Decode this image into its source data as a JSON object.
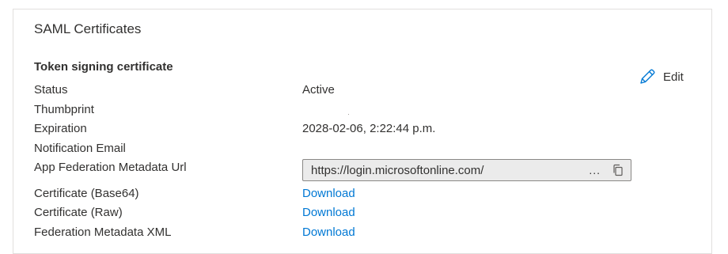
{
  "card": {
    "title": "SAML Certificates",
    "section_title": "Token signing certificate",
    "edit_label": "Edit",
    "edit_icon": "pencil-icon",
    "accent_color": "#0078d4"
  },
  "rows": {
    "status": {
      "label": "Status",
      "value": "Active"
    },
    "thumbprint": {
      "label": "Thumbprint",
      "value": ""
    },
    "expiration": {
      "label": "Expiration",
      "value": "2028-02-06, 2:22:44 p.m."
    },
    "notification_email": {
      "label": "Notification Email",
      "value": ""
    },
    "metadata_url": {
      "label": "App Federation Metadata Url",
      "value": "https://login.microsoftonline.com/",
      "ellipsis": "...",
      "copy_icon": "copy-icon"
    },
    "cert_base64": {
      "label": "Certificate (Base64)",
      "link": "Download"
    },
    "cert_raw": {
      "label": "Certificate (Raw)",
      "link": "Download"
    },
    "federation_xml": {
      "label": "Federation Metadata XML",
      "link": "Download"
    }
  }
}
